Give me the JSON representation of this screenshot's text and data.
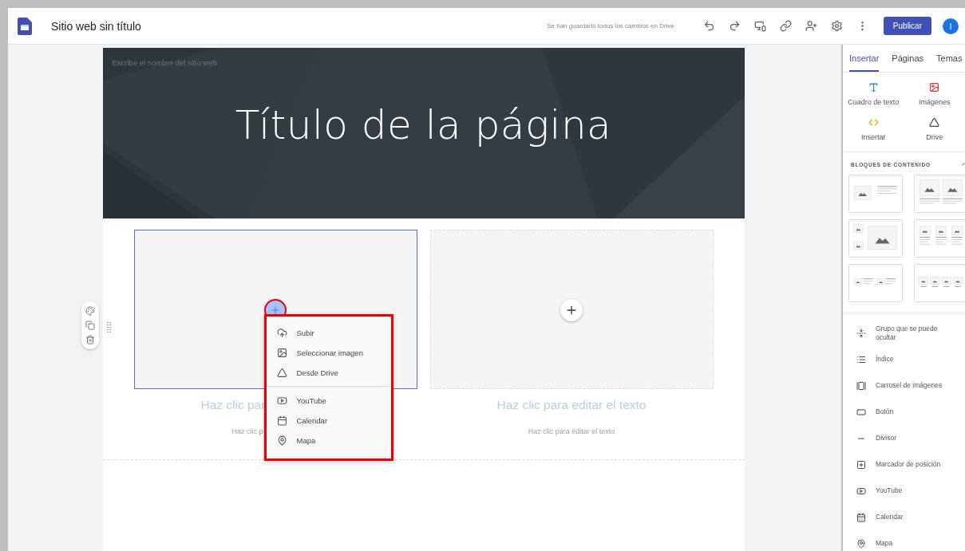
{
  "app": {
    "title": "Sitio web sin título",
    "save_status": "Se han guardado todos los cambios en Drive",
    "publish_button": "Publicar",
    "avatar": "I"
  },
  "page": {
    "site_name_placeholder": "Escribe el nombre del sitio web",
    "title": "Título de la página",
    "columns": [
      {
        "selected": true,
        "heading": "Haz clic par",
        "body": "Haz clic p"
      },
      {
        "selected": false,
        "heading": "Haz clic para editar el texto",
        "body": "Haz clic para editar el texto"
      }
    ],
    "insert_menu": {
      "groups": [
        [
          "Subir",
          "Seleccionar imagen",
          "Desde Drive"
        ],
        [
          "YouTube",
          "Calendar",
          "Mapa"
        ]
      ]
    }
  },
  "sidebar": {
    "tabs": [
      {
        "label": "Insertar",
        "selected": true
      },
      {
        "label": "Páginas",
        "selected": false
      },
      {
        "label": "Temas",
        "selected": false
      }
    ],
    "tools": [
      "Cuadro de texto",
      "Imágenes",
      "Insertar",
      "Drive"
    ],
    "blocks_heading": "BLOQUES DE CONTENIDO",
    "components": [
      "Grupo que se puede ocultar",
      "Índice",
      "Carrusel de imágenes",
      "Botón",
      "Divisor",
      "Marcador de posición",
      "YouTube",
      "Calendar",
      "Mapa"
    ]
  }
}
